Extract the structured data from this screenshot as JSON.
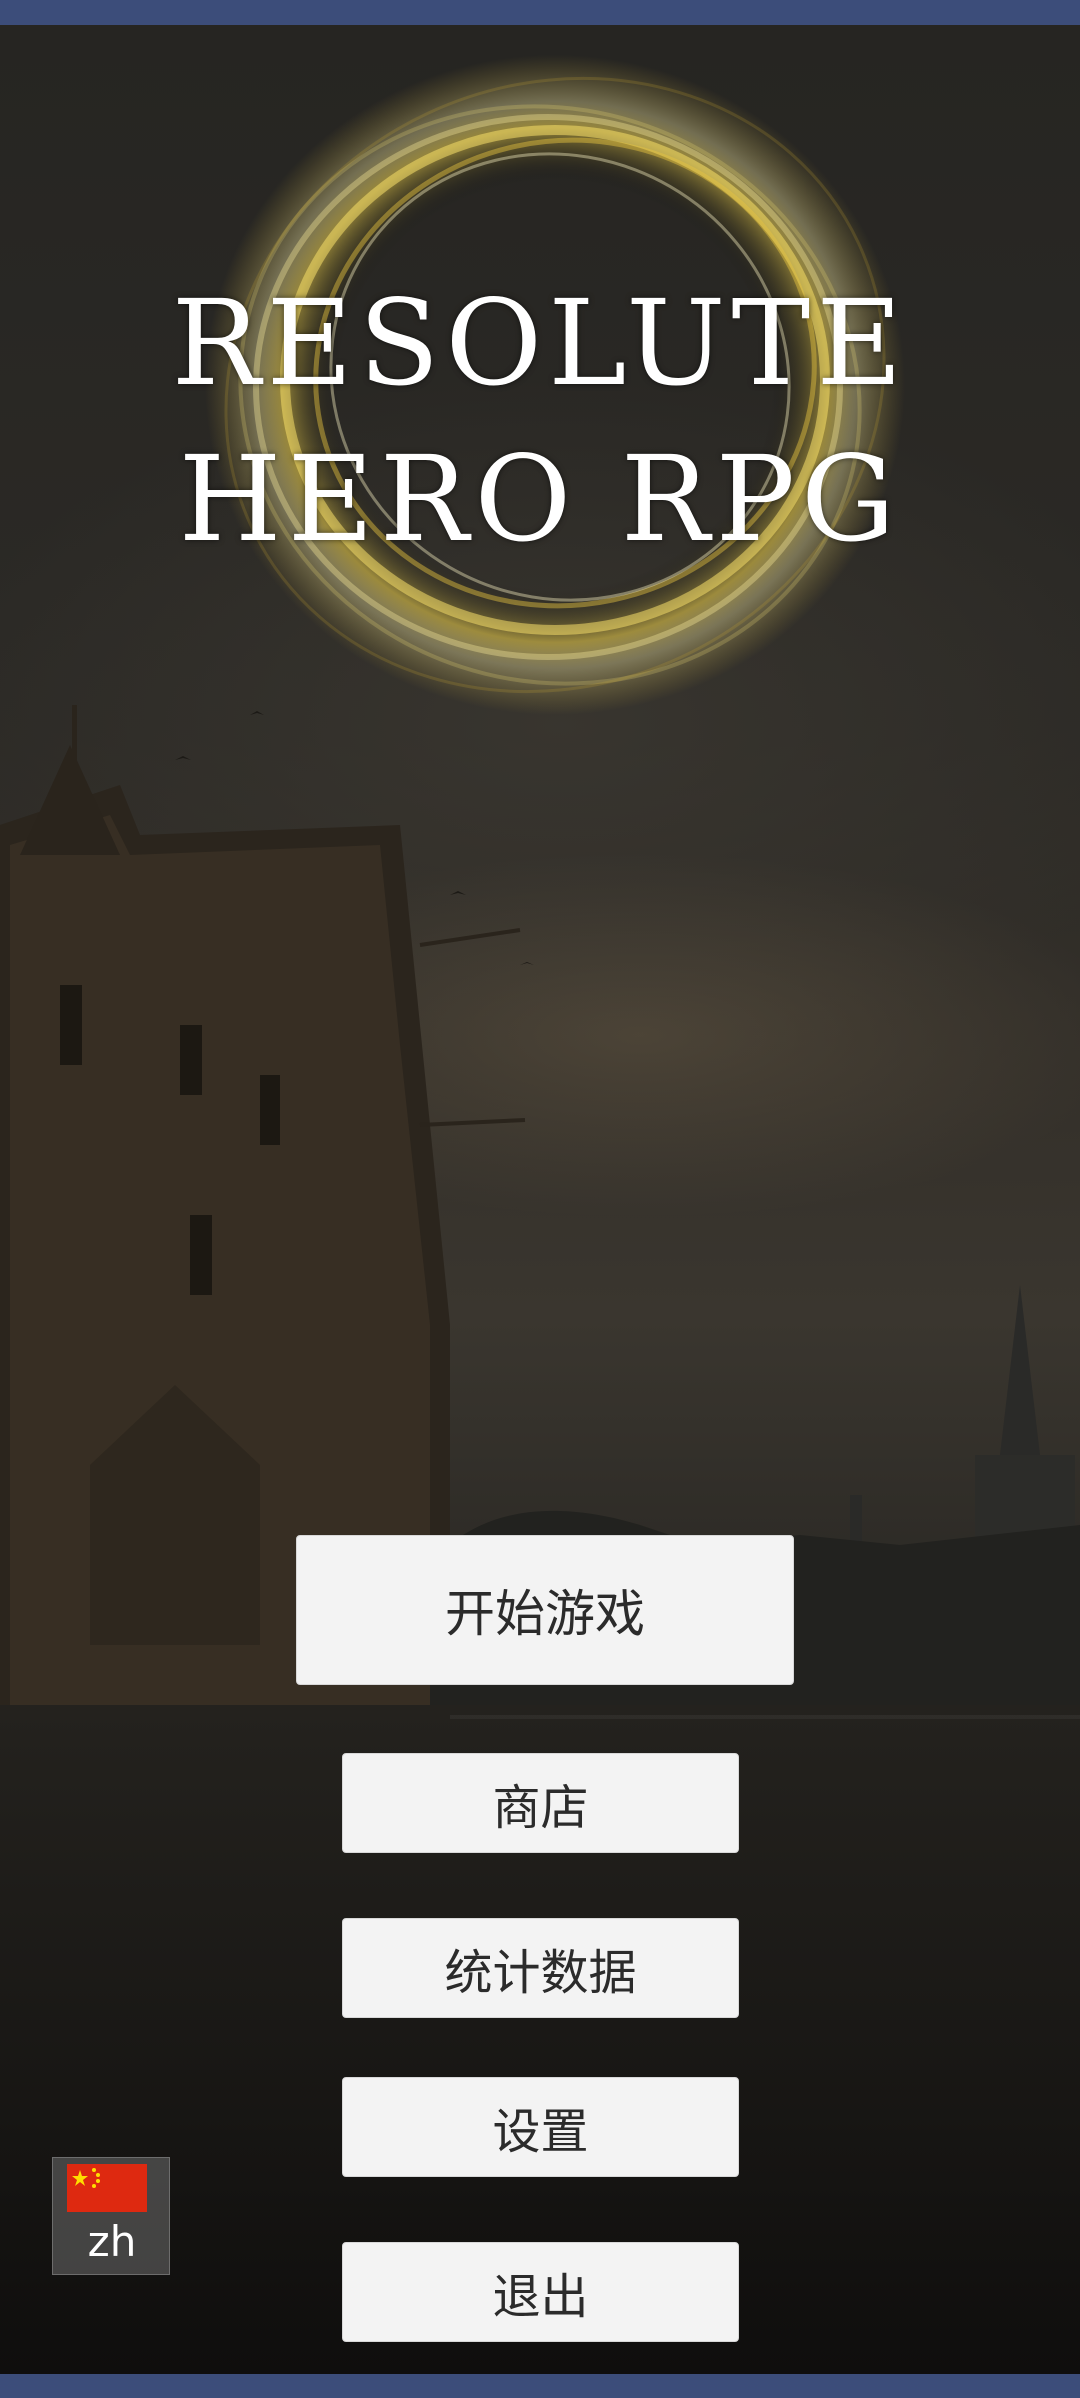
{
  "game": {
    "title_line_1": "RESOLUTE",
    "title_line_2": "HERO RPG"
  },
  "menu": {
    "start_label": "开始游戏",
    "shop_label": "商店",
    "stats_label": "统计数据",
    "settings_label": "设置",
    "exit_label": "退出"
  },
  "language": {
    "code": "zh",
    "flag_icon": "china-flag-icon"
  },
  "colors": {
    "system_bar": "#3c4d7a",
    "button_bg": "#f3f3f3",
    "title_text": "#ffffff",
    "glow": "#f0d24a"
  }
}
